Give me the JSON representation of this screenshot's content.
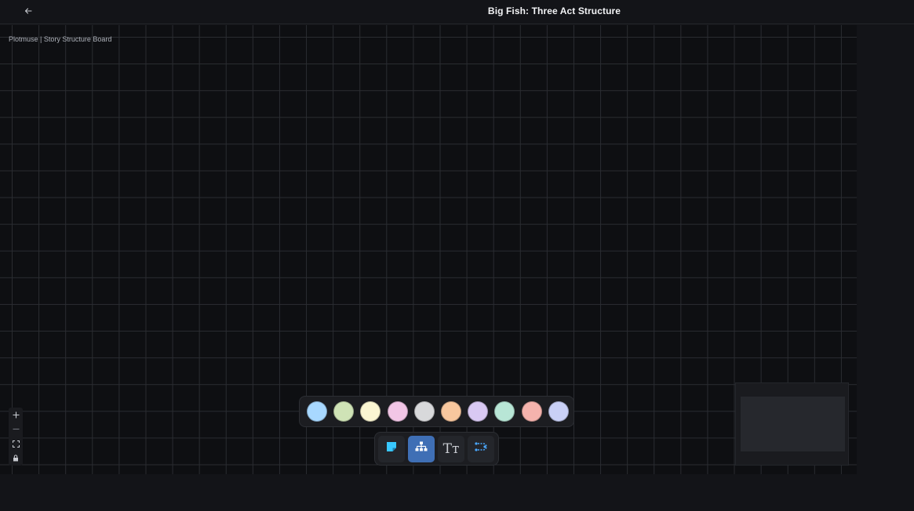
{
  "header": {
    "title": "Big Fish: Three Act Structure",
    "back_icon": "arrow-left-icon"
  },
  "canvas": {
    "attribution": "Plotmuse | Story Structure Board",
    "grid": true
  },
  "zoom_controls": [
    {
      "name": "zoom-in",
      "icon": "plus-icon"
    },
    {
      "name": "zoom-out",
      "icon": "minus-icon"
    },
    {
      "name": "fit-view",
      "icon": "fit-view-icon"
    },
    {
      "name": "lock",
      "icon": "lock-icon"
    }
  ],
  "palette": {
    "colors": [
      "#a8d8ff",
      "#cfe3b6",
      "#fbf6d2",
      "#f2c6e6",
      "#d8d9db",
      "#f8c79e",
      "#d9c9f3",
      "#b8e6d6",
      "#f5b3ad",
      "#c9d0f6"
    ]
  },
  "toolbar": {
    "tools": [
      {
        "name": "sticky-note",
        "icon": "sticky-note-icon",
        "active": false
      },
      {
        "name": "structure",
        "icon": "hierarchy-icon",
        "active": true
      },
      {
        "name": "text",
        "icon": "text-icon",
        "label": "Tт",
        "active": false
      },
      {
        "name": "connector",
        "icon": "connector-icon",
        "active": false
      }
    ]
  },
  "colors": {
    "accent": "#3f6fb5",
    "sticky": "#38c8ff",
    "connector": "#4aa8ff"
  }
}
